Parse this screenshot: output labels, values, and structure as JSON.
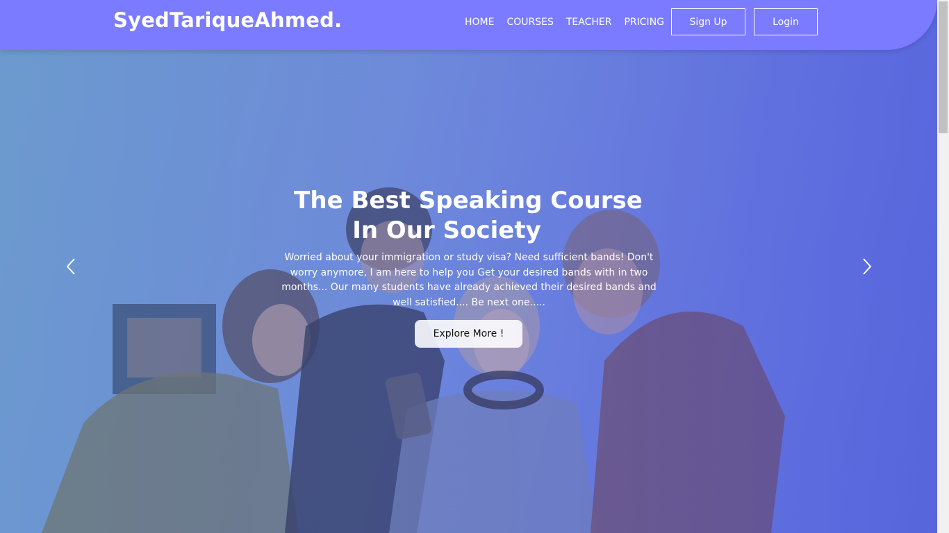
{
  "nav": {
    "brand": "SyedTariqueAhmed.",
    "links": [
      {
        "label": "HOME"
      },
      {
        "label": "COURSES"
      },
      {
        "label": "TEACHER"
      },
      {
        "label": "PRICING"
      }
    ],
    "signup_label": "Sign Up",
    "login_label": "Login"
  },
  "hero": {
    "title_line1": "The Best Speaking Course",
    "title_line2": "In Our Society",
    "description": "Worried about your immigration or study visa? Need sufficient bands! Don't worry anymore, I am here to help you Get your desired bands with in two months... Our many students have already achieved their desired bands and well satisfied.... Be next one.....",
    "cta_label": "Explore More !",
    "prev_icon": "chevron-left-icon",
    "next_icon": "chevron-right-icon"
  },
  "colors": {
    "navbar": "#7b7bff",
    "overlay": "#6d7fe0",
    "text": "#ffffff"
  }
}
